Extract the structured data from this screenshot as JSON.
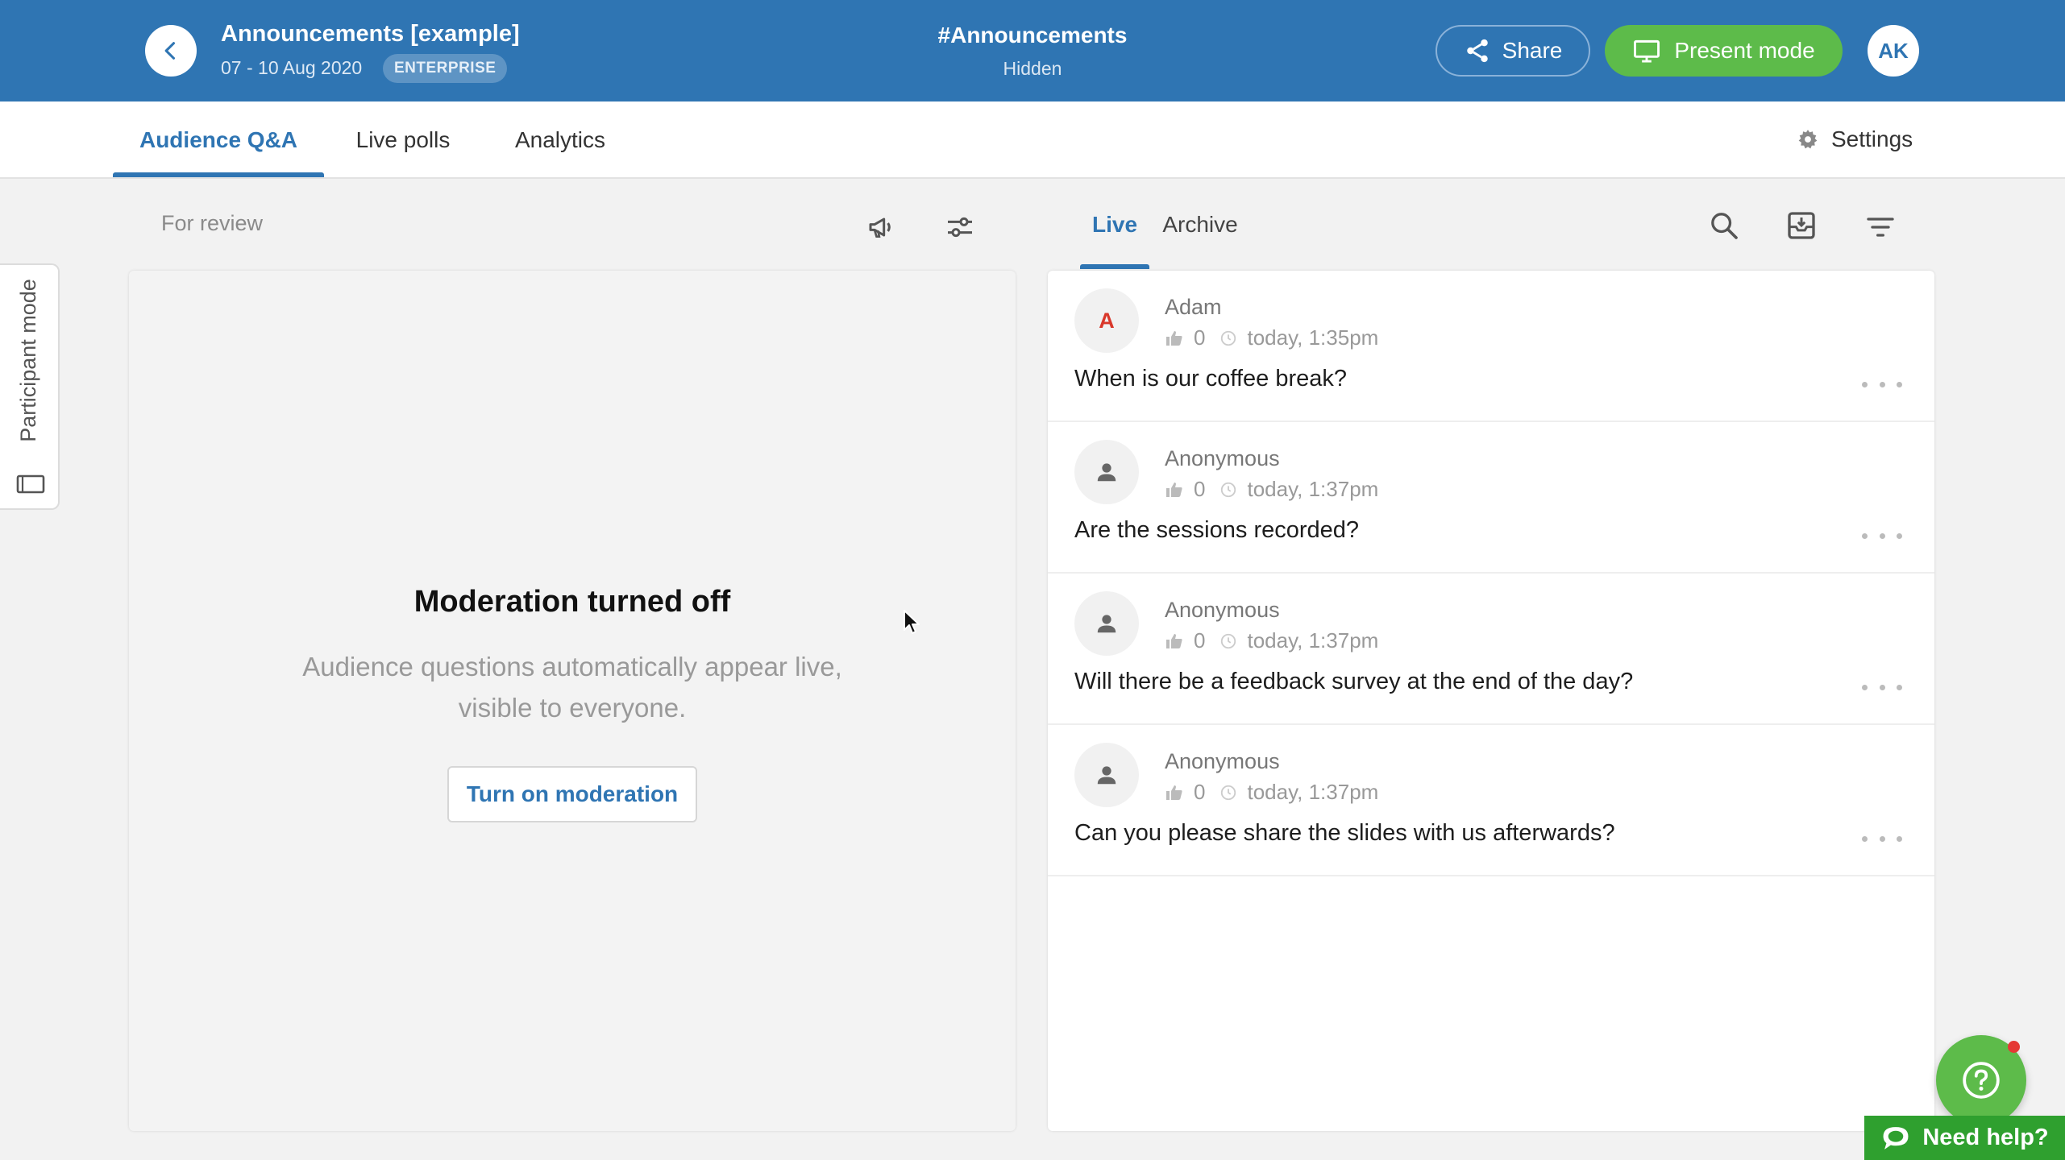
{
  "header": {
    "title": "Announcements [example]",
    "date_range": "07 - 10 Aug 2020",
    "plan_badge": "ENTERPRISE",
    "room_name": "#Announcements",
    "room_status": "Hidden",
    "share_label": "Share",
    "present_label": "Present mode",
    "avatar_initials": "AK",
    "colors": {
      "bar": "#2f75b3",
      "present_button": "#5dbb4a"
    }
  },
  "nav": {
    "tabs": [
      {
        "label": "Audience Q&A",
        "active": true
      },
      {
        "label": "Live polls",
        "active": false
      },
      {
        "label": "Analytics",
        "active": false
      }
    ],
    "settings_label": "Settings"
  },
  "review": {
    "heading": "For review",
    "empty_title": "Moderation turned off",
    "empty_desc": "Audience questions automatically appear live, visible to everyone.",
    "button_label": "Turn on moderation"
  },
  "side_tab": {
    "label": "Participant mode"
  },
  "questions_panel": {
    "tabs": [
      {
        "label": "Live",
        "active": true
      },
      {
        "label": "Archive",
        "active": false
      }
    ],
    "items": [
      {
        "author": "Adam",
        "avatar_letter": "A",
        "likes": "0",
        "time": "today, 1:35pm",
        "text": "When is our coffee break?"
      },
      {
        "author": "Anonymous",
        "avatar_letter": "",
        "likes": "0",
        "time": "today, 1:37pm",
        "text": "Are the sessions recorded?"
      },
      {
        "author": "Anonymous",
        "avatar_letter": "",
        "likes": "0",
        "time": "today, 1:37pm",
        "text": "Will there be a feedback survey at the end of the day?"
      },
      {
        "author": "Anonymous",
        "avatar_letter": "",
        "likes": "0",
        "time": "today, 1:37pm",
        "text": "Can you please share the slides with us afterwards?"
      }
    ]
  },
  "help": {
    "label": "Need help?"
  }
}
